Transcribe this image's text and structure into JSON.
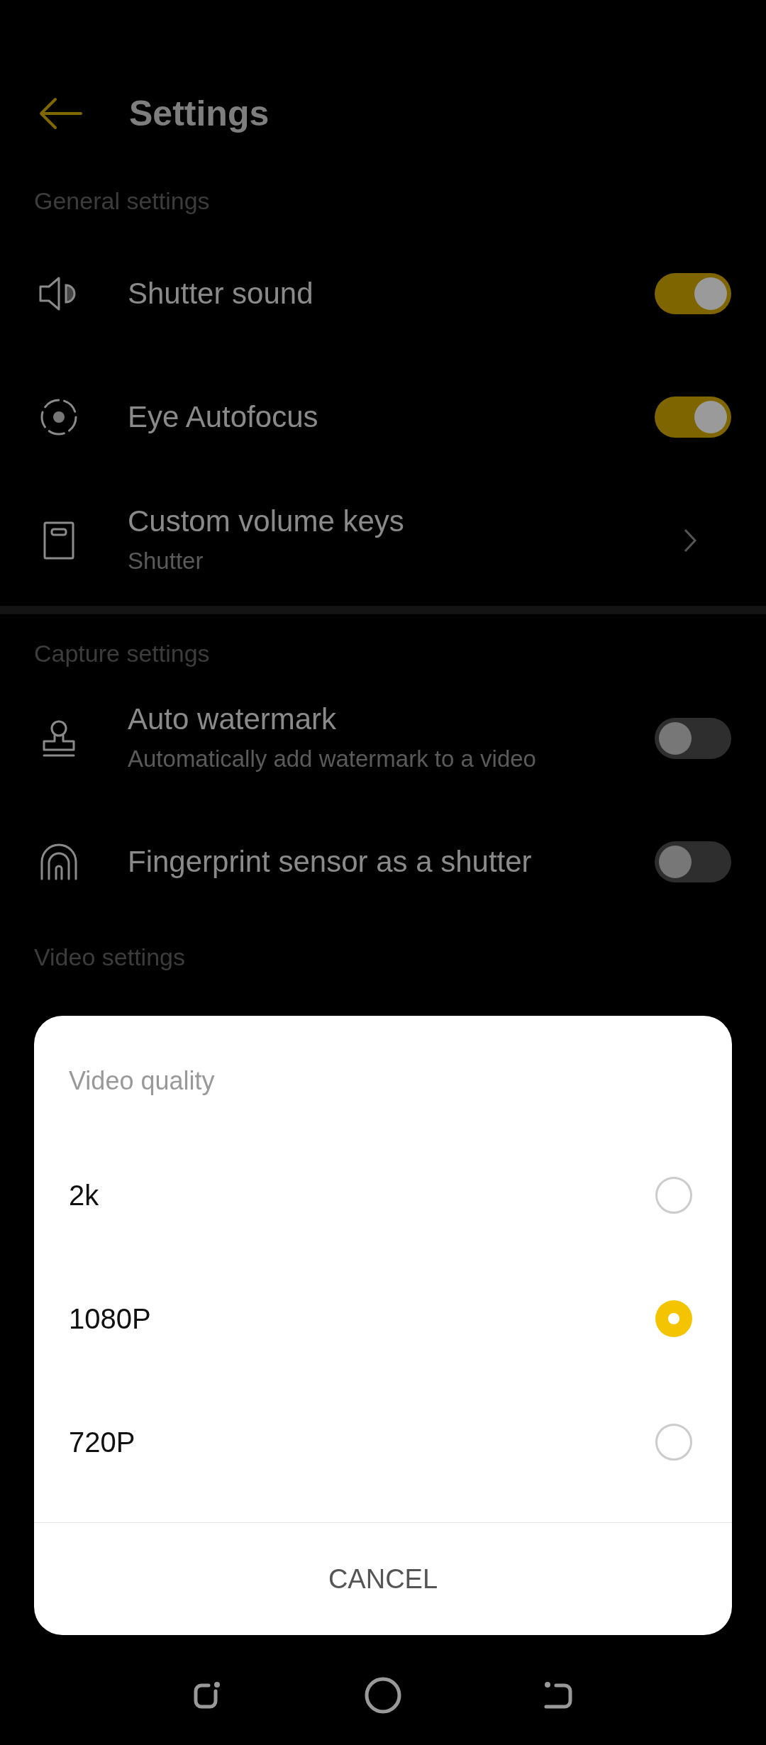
{
  "header": {
    "title": "Settings"
  },
  "sections": [
    {
      "label": "General settings",
      "items": [
        {
          "kind": "toggle",
          "title": "Shutter sound",
          "on": true
        },
        {
          "kind": "toggle",
          "title": "Eye Autofocus",
          "on": true
        },
        {
          "kind": "link",
          "title": "Custom volume keys",
          "subtitle": "Shutter"
        }
      ]
    },
    {
      "label": "Capture settings",
      "items": [
        {
          "kind": "toggle",
          "title": "Auto watermark",
          "subtitle": "Automatically add watermark to a video",
          "on": false
        },
        {
          "kind": "toggle",
          "title": "Fingerprint sensor as a shutter",
          "on": false
        }
      ]
    },
    {
      "label": "Video settings"
    }
  ],
  "dialog": {
    "title": "Video quality",
    "options": [
      {
        "label": "2k",
        "selected": false
      },
      {
        "label": "1080P",
        "selected": true
      },
      {
        "label": "720P",
        "selected": false
      }
    ],
    "cancel": "CANCEL"
  }
}
